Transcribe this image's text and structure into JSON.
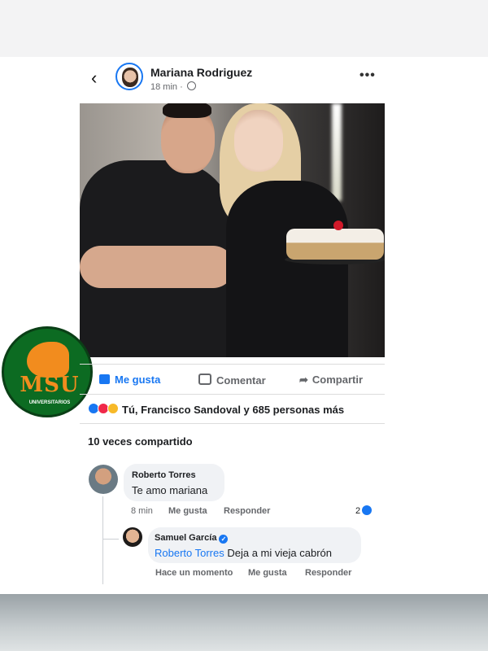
{
  "post": {
    "author": "Mariana Rodriguez",
    "time": "18 min ·",
    "like_label": "Me gusta",
    "comment_label": "Comentar",
    "share_label": "Compartir",
    "reactions_text": "Tú, Francisco Sandoval y 685 personas más",
    "shares_text": "10 veces compartido"
  },
  "logo": {
    "letters": "MSU",
    "subtitle": "UNIVERSITARIOS"
  },
  "comments": [
    {
      "name": "Roberto Torres",
      "text": "Te amo mariana",
      "time": "8 min",
      "like": "Me gusta",
      "reply": "Responder",
      "like_count": "2"
    },
    {
      "name": "Samuel García",
      "tag": "Roberto Torres",
      "text": " Deja a mi vieja cabrón",
      "time": "Hace un momento",
      "like": "Me gusta",
      "reply": "Responder"
    }
  ],
  "colors": {
    "accent": "#1877f2",
    "logo_green": "#0c6b22",
    "logo_orange": "#f28c1e"
  },
  "icons": [
    "back-arrow-icon",
    "globe-icon",
    "more-icon",
    "thumbs-up-icon",
    "comment-icon",
    "share-icon",
    "verified-icon"
  ]
}
